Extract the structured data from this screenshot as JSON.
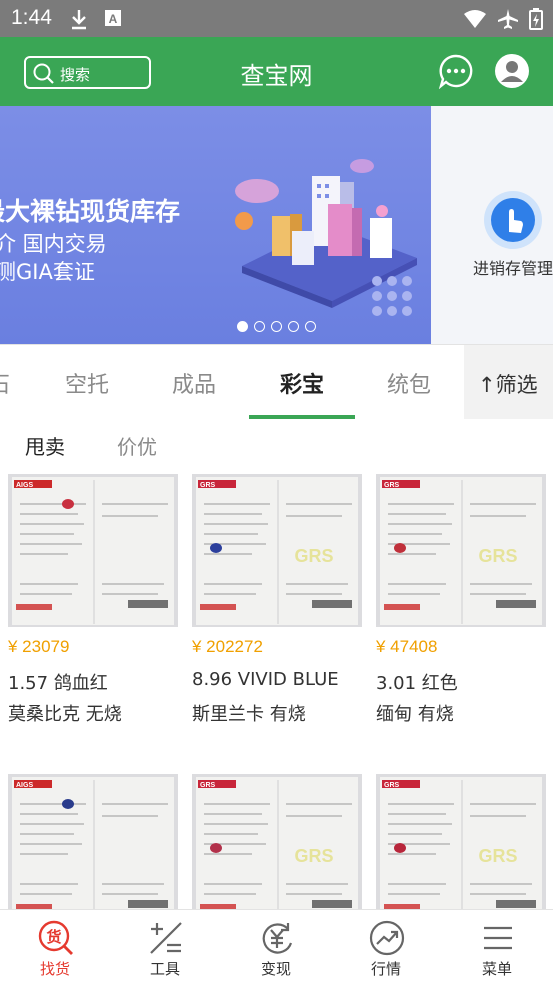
{
  "status": {
    "time": "1:44"
  },
  "appbar": {
    "search_label": "搜索",
    "title": "查宝网"
  },
  "banner": {
    "line1": "最大裸钻现货库存",
    "line2": "介 国内交易",
    "line3": "测GIA套证",
    "side_caption": "进销存管理",
    "dots_total": 5,
    "dots_active": 1
  },
  "tabs": [
    {
      "label": "石",
      "active": false
    },
    {
      "label": "空托",
      "active": false
    },
    {
      "label": "成品",
      "active": false
    },
    {
      "label": "彩宝",
      "active": true
    },
    {
      "label": "统包",
      "active": false
    }
  ],
  "filter_label": "↑筛选",
  "subtabs": [
    {
      "label": "甩卖",
      "active": true
    },
    {
      "label": "价优",
      "active": false
    }
  ],
  "products": [
    {
      "price": "¥ 23079",
      "line1": "1.57  鸽血红",
      "line2": "莫桑比克  无烧",
      "lab": "AIGS",
      "stone": "#c8303f"
    },
    {
      "price": "¥ 202272",
      "line1": "8.96  VIVID BLUE",
      "line2": "斯里兰卡  有烧",
      "lab": "GRS",
      "stone": "#2c3f9c"
    },
    {
      "price": "¥ 47408",
      "line1": "3.01  红色",
      "line2": "缅甸  有烧",
      "lab": "GRS",
      "stone": "#c0303a"
    },
    {
      "price": "",
      "line1": "",
      "line2": "",
      "lab": "AIGS",
      "stone": "#2a3c8c"
    },
    {
      "price": "",
      "line1": "",
      "line2": "",
      "lab": "GRS",
      "stone": "#b2314a"
    },
    {
      "price": "",
      "line1": "",
      "line2": "",
      "lab": "GRS",
      "stone": "#b8263a"
    }
  ],
  "bottom_nav": [
    {
      "label": "找货",
      "icon": "find-goods-icon",
      "active": true
    },
    {
      "label": "工具",
      "icon": "tools-icon",
      "active": false
    },
    {
      "label": "变现",
      "icon": "cash-icon",
      "active": false
    },
    {
      "label": "行情",
      "icon": "trend-icon",
      "active": false
    },
    {
      "label": "菜单",
      "icon": "menu-icon",
      "active": false
    }
  ],
  "colors": {
    "brand_green": "#3aa655",
    "price_orange": "#f0a000",
    "nav_active_red": "#e53a2f"
  }
}
